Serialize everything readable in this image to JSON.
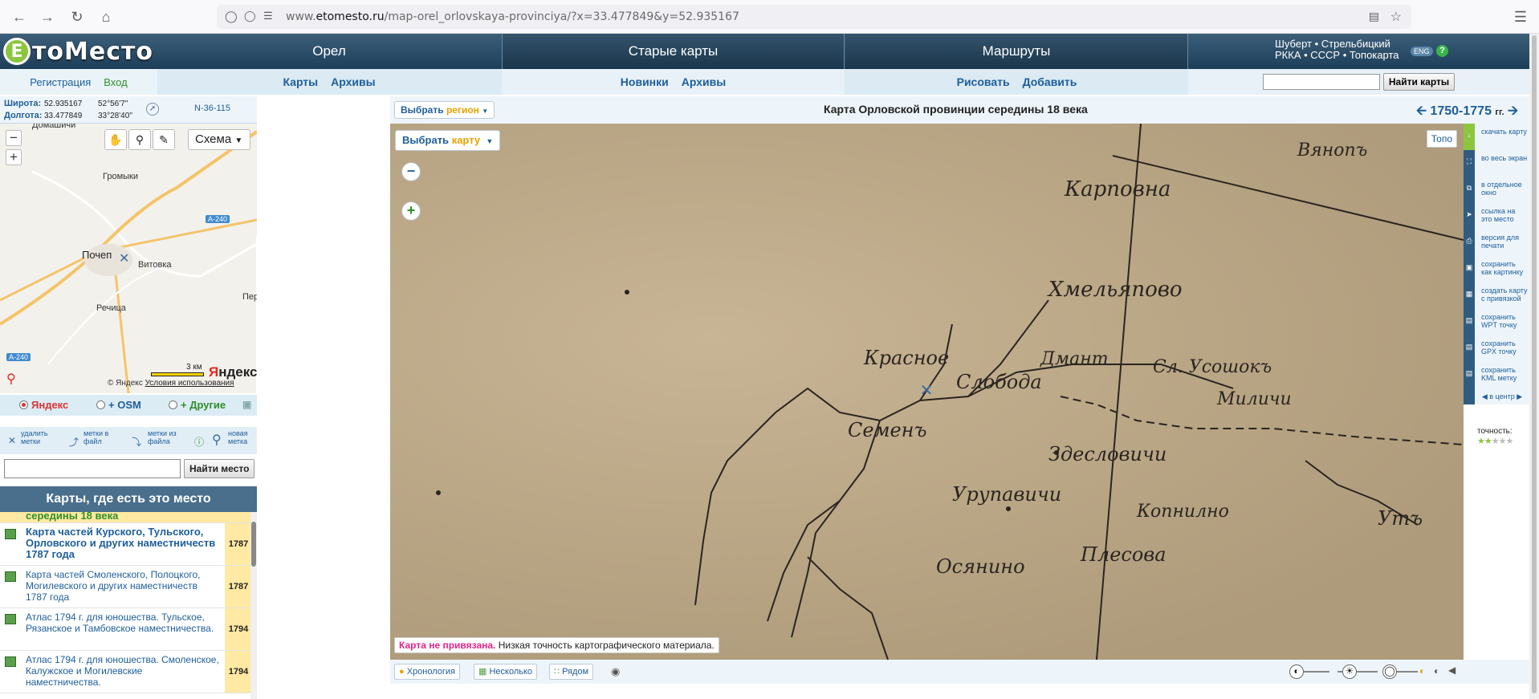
{
  "browser": {
    "url_prefix": "www.",
    "url_domain": "etomesto.ru",
    "url_path": "/map-orel_orlovskaya-provinciya/?x=33.477849&y=52.935167"
  },
  "header": {
    "logo_text": "ЕтоМесто",
    "logo_letter": "Е",
    "logo_rest": "тоМесто",
    "tab_orel": "Орел",
    "tab_old_maps": "Старые карты",
    "tab_routes": "Маршруты",
    "right_line1": "Шуберт • Стрельбицкий",
    "right_line2": "РККА • СССР • Топокарта",
    "eng": "ENG",
    "help": "?"
  },
  "subnav": {
    "register": "Регистрация",
    "login": "Вход",
    "orel_maps": "Карты",
    "orel_archives": "Архивы",
    "old_new": "Новинки",
    "old_archives": "Архивы",
    "routes_draw": "Рисовать",
    "routes_add": "Добавить",
    "search_button": "Найти карты"
  },
  "coords": {
    "lat_label": "Широта:",
    "lat_value": "52.935167",
    "lat_dms": "52°56'7''",
    "lon_label": "Долгота:",
    "lon_value": "33.477849",
    "lon_dms": "33°28'40''",
    "sheet": "N-36-115"
  },
  "mini_map": {
    "scheme_label": "Схема",
    "places": [
      "Домашичи",
      "Громыки",
      "Почеп",
      "Витовка",
      "Речица",
      "Пер"
    ],
    "road_labels": [
      "A-240",
      "A-240"
    ],
    "scale": "3 км",
    "copyright": "© Яндекс",
    "terms": "Условия использования",
    "logo": "Яндекс"
  },
  "providers": {
    "yandex": "Яндекс",
    "osm": "+ OSM",
    "other": "+ Другие"
  },
  "marks": {
    "delete": "удалить метки",
    "to_file": "метки в файл",
    "from_file": "метки из файла",
    "new": "новая метка"
  },
  "place_search": {
    "button": "Найти место"
  },
  "maps_panel": {
    "heading": "Карты, где есть это место",
    "items": [
      {
        "title": "середины 18 века",
        "year": "",
        "bold": true
      },
      {
        "title": "Карта частей Курского, Тульского, Орловского и других наместничеств 1787 года",
        "year": "1787",
        "bold": true
      },
      {
        "title": "Карта частей Смоленского, Полоцкого, Могилевского и других наместничеств 1787 года",
        "year": "1787",
        "bold": false
      },
      {
        "title": "Атлас 1794 г. для юношества. Тульское, Рязанское и Тамбовское наместничества.",
        "year": "1794",
        "bold": false
      },
      {
        "title": "Атлас 1794 г. для юношества. Смоленское, Калужское и Могилевские наместничества.",
        "year": "1794",
        "bold": false
      }
    ]
  },
  "map_panel": {
    "choose_region": "Выбрать",
    "choose_region_b": "регион",
    "title": "Карта Орловской провинции середины 18 века",
    "years": "1750-1775",
    "years_suffix": "гг.",
    "choose_map": "Выбрать",
    "choose_map_b": "карту",
    "topo": "Топо",
    "note_bold": "Карта не привязана.",
    "note_rest": "Низкая точность картографического материала.",
    "map_labels": [
      "Карповна",
      "Хмельяпово",
      "Красное",
      "Слобода",
      "Дмант",
      "Сл. Усошокъ",
      "Миличи",
      "Семенъ",
      "Здесловичи",
      "Урупавичи",
      "Копнилно",
      "Осянино",
      "Плесова",
      "Утъ",
      "Вянопъ"
    ]
  },
  "bottom_bar": {
    "chronology": "Хронология",
    "several": "Несколько",
    "side_by_side": "Рядом"
  },
  "right_tools": [
    "скачать карту",
    "во весь экран",
    "в отдельное окно",
    "ссылка на это место",
    "версия для печати",
    "сохранить как картинку",
    "создать карту с привязкой",
    "сохранить WPT точку",
    "сохранить GPX точку",
    "сохранить KML метку",
    "в центр"
  ],
  "accuracy": {
    "label": "точность:",
    "value": 2,
    "max": 5
  }
}
